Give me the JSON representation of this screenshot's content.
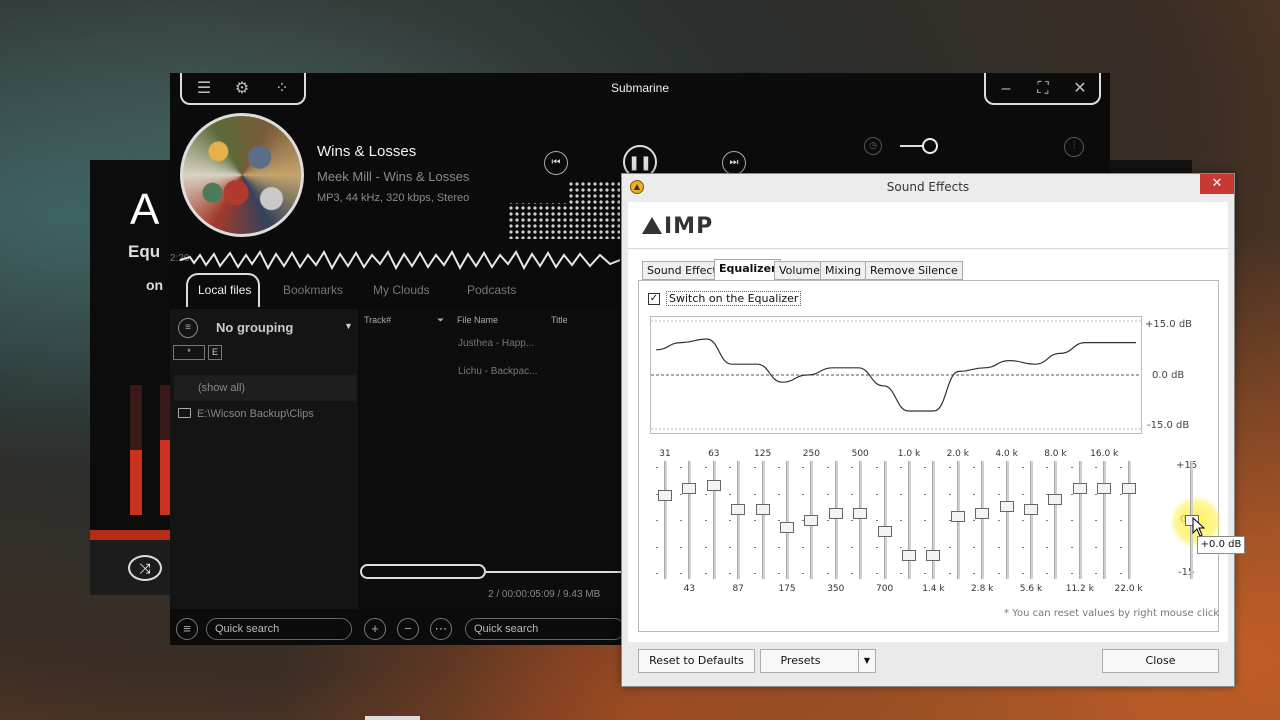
{
  "background_window": {
    "logo": "A",
    "label_eq": "Equ",
    "label_on": "on"
  },
  "main_window": {
    "title": "Submarine",
    "track": {
      "title": "Wins & Losses",
      "artist_album": "Meek Mill - Wins & Losses",
      "meta": "MP3, 44 kHz, 320 kbps, Stereo"
    },
    "wave_time": "2:20",
    "tabs": [
      {
        "label": "Local files",
        "active": true
      },
      {
        "label": "Bookmarks",
        "active": false
      },
      {
        "label": "My Clouds",
        "active": false
      },
      {
        "label": "Podcasts",
        "active": false
      }
    ],
    "grouping": "No grouping",
    "filter_buttons": [
      "*",
      "E"
    ],
    "show_all": "(show all)",
    "folder": "E:\\Wicson Backup\\Clips",
    "columns": [
      "Track#",
      "File Name",
      "Title"
    ],
    "rows": [
      "Justhea - Happ...",
      "Lichu - Backpac..."
    ],
    "status": "2 / 00:00:05:09 / 9.43 MB",
    "search_placeholder": "Quick search",
    "search_placeholder2": "Quick search"
  },
  "dialog": {
    "title": "Sound Effects",
    "logo": "IMP",
    "tabs": [
      {
        "label": "Sound Effects",
        "active": false
      },
      {
        "label": "Equalizer",
        "active": true
      },
      {
        "label": "Volume",
        "active": false
      },
      {
        "label": "Mixing",
        "active": false
      },
      {
        "label": "Remove Silence",
        "active": false
      }
    ],
    "switch_label": "Switch on the Equalizer",
    "switch_checked": true,
    "curve_labels": {
      "top": "+15.0 dB",
      "mid": "0.0 dB",
      "bottom": "-15.0 dB"
    },
    "freq_top": [
      "31",
      "63",
      "125",
      "250",
      "500",
      "1.0 k",
      "2.0 k",
      "4.0 k",
      "8.0 k",
      "16.0 k"
    ],
    "freq_bottom": [
      "43",
      "87",
      "175",
      "350",
      "700",
      "1.4 k",
      "2.8 k",
      "5.6 k",
      "11.2 k",
      "22.0 k"
    ],
    "band_gains_db": [
      7,
      9,
      10,
      3,
      3,
      -2,
      0,
      2,
      2,
      -3,
      -10,
      -10,
      1,
      2,
      4,
      3,
      6,
      9,
      9,
      9
    ],
    "preamp_db": 0,
    "preamp_scale": {
      "top": "+15",
      "mid": "0",
      "bottom": "-15"
    },
    "tooltip": "+0.0 dB",
    "hint": "* You can reset values by right mouse click",
    "buttons": {
      "reset": "Reset to Defaults",
      "presets": "Presets",
      "close": "Close"
    }
  }
}
